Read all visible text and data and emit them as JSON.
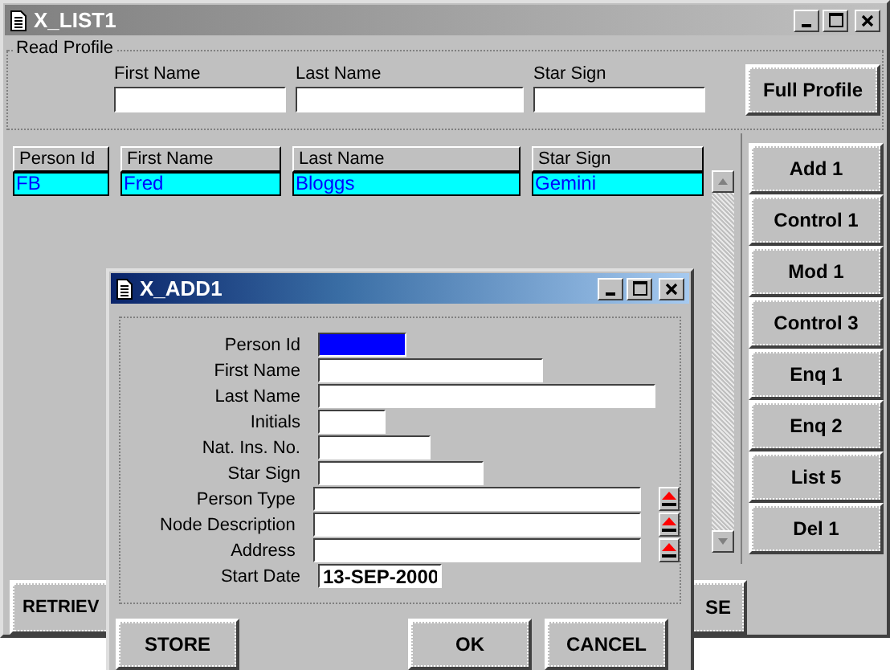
{
  "main_window": {
    "title": "X_LIST1",
    "read_profile": {
      "title": "Read Profile",
      "fields": [
        {
          "label": "First Name"
        },
        {
          "label": "Last Name"
        },
        {
          "label": "Star Sign"
        }
      ],
      "button": "Full Profile"
    },
    "list": {
      "columns": [
        "Person Id",
        "First Name",
        "Last Name",
        "Star Sign"
      ],
      "rows": [
        {
          "cells": [
            "FB",
            "Fred",
            "Bloggs",
            "Gemini"
          ],
          "selected": true
        }
      ]
    },
    "side_buttons": [
      "Add 1",
      "Control 1",
      "Mod 1",
      "Control 3",
      "Enq 1",
      "Enq 2",
      "List 5",
      "Del 1"
    ],
    "bottom_buttons": [
      "RETRIEV",
      "SE"
    ]
  },
  "dialog": {
    "title": "X_ADD1",
    "fields": [
      {
        "label": "Person Id",
        "kind": "text",
        "focused": true
      },
      {
        "label": "First Name",
        "kind": "text",
        "focused": false
      },
      {
        "label": "Last Name",
        "kind": "text",
        "focused": false
      },
      {
        "label": "Initials",
        "kind": "text",
        "focused": false
      },
      {
        "label": "Nat. Ins. No.",
        "kind": "text",
        "focused": false
      },
      {
        "label": "Star Sign",
        "kind": "text",
        "focused": false
      },
      {
        "label": "Person Type",
        "kind": "lookup",
        "focused": false
      },
      {
        "label": "Node Description",
        "kind": "lookup",
        "focused": false
      },
      {
        "label": "Address",
        "kind": "lookup",
        "focused": false
      },
      {
        "label": "Start Date",
        "kind": "text",
        "focused": false,
        "value": "13-SEP-2000"
      }
    ],
    "buttons": [
      "STORE",
      "OK",
      "CANCEL"
    ]
  }
}
